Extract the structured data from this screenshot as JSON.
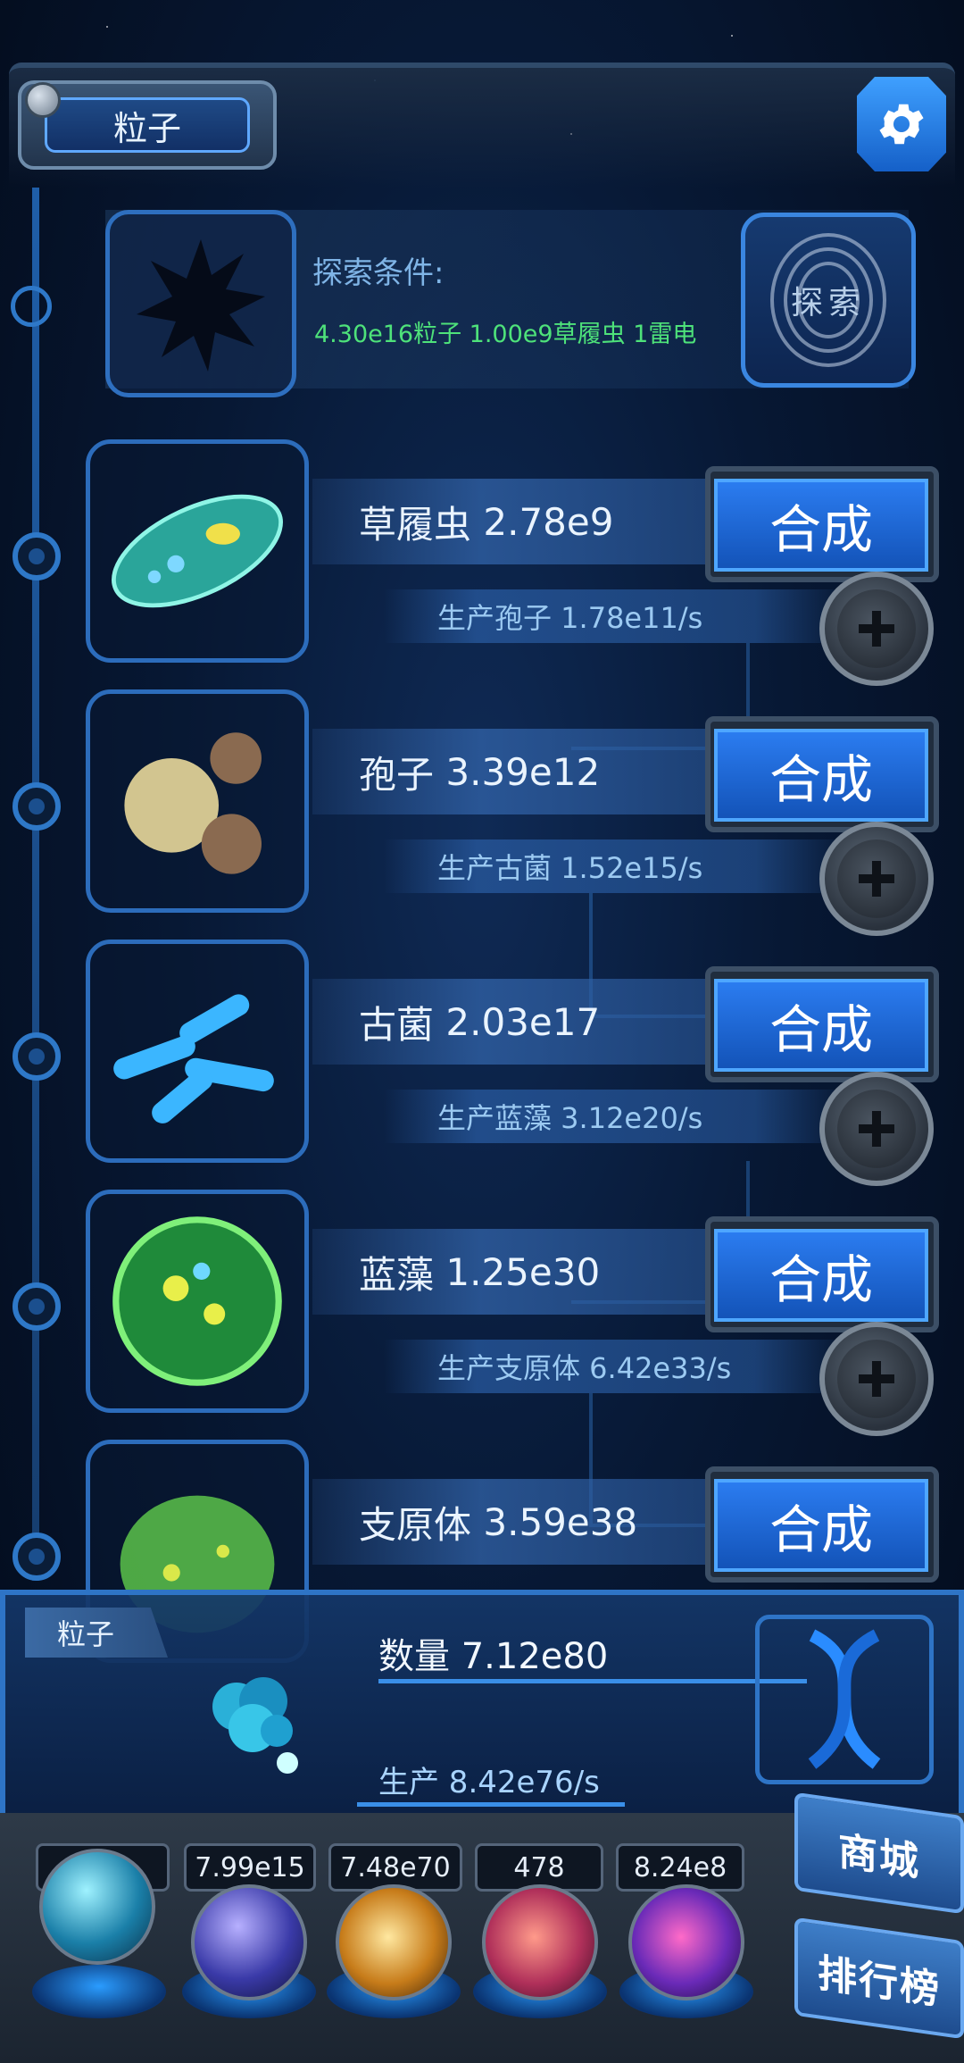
{
  "header": {
    "tab_label": "粒子"
  },
  "explore": {
    "title": "探索条件:",
    "conditions": "4.30e16粒子 1.00e9草履虫 1雷电",
    "button_label": "探索"
  },
  "species": [
    {
      "name": "草履虫",
      "amount": "2.78e9",
      "production": "生产孢子 1.78e11/s",
      "combine_label": "合成"
    },
    {
      "name": "孢子",
      "amount": "3.39e12",
      "production": "生产古菌 1.52e15/s",
      "combine_label": "合成"
    },
    {
      "name": "古菌",
      "amount": "2.03e17",
      "production": "生产蓝藻 3.12e20/s",
      "combine_label": "合成"
    },
    {
      "name": "蓝藻",
      "amount": "1.25e30",
      "production": "生产支原体 6.42e33/s",
      "combine_label": "合成"
    },
    {
      "name": "支原体",
      "amount": "3.59e38",
      "production": "",
      "combine_label": "合成"
    }
  ],
  "particle_panel": {
    "label": "粒子",
    "count": "数量 7.12e80",
    "production": "生产 8.42e76/s"
  },
  "resources": [
    {
      "value": "…0",
      "icon": "particle-orb-icon"
    },
    {
      "value": "7.99e15",
      "icon": "lightning-orb-icon"
    },
    {
      "value": "7.48e70",
      "icon": "galaxy-orb-icon"
    },
    {
      "value": "478",
      "icon": "brain-orb-icon"
    },
    {
      "value": "8.24e8",
      "icon": "vortex-orb-icon"
    }
  ],
  "side_buttons": {
    "shop": "商城",
    "ranking": "排行榜"
  },
  "colors": {
    "accent": "#2b7cf0",
    "condition_text": "#4ee27a",
    "frame": "#2e74c6"
  }
}
